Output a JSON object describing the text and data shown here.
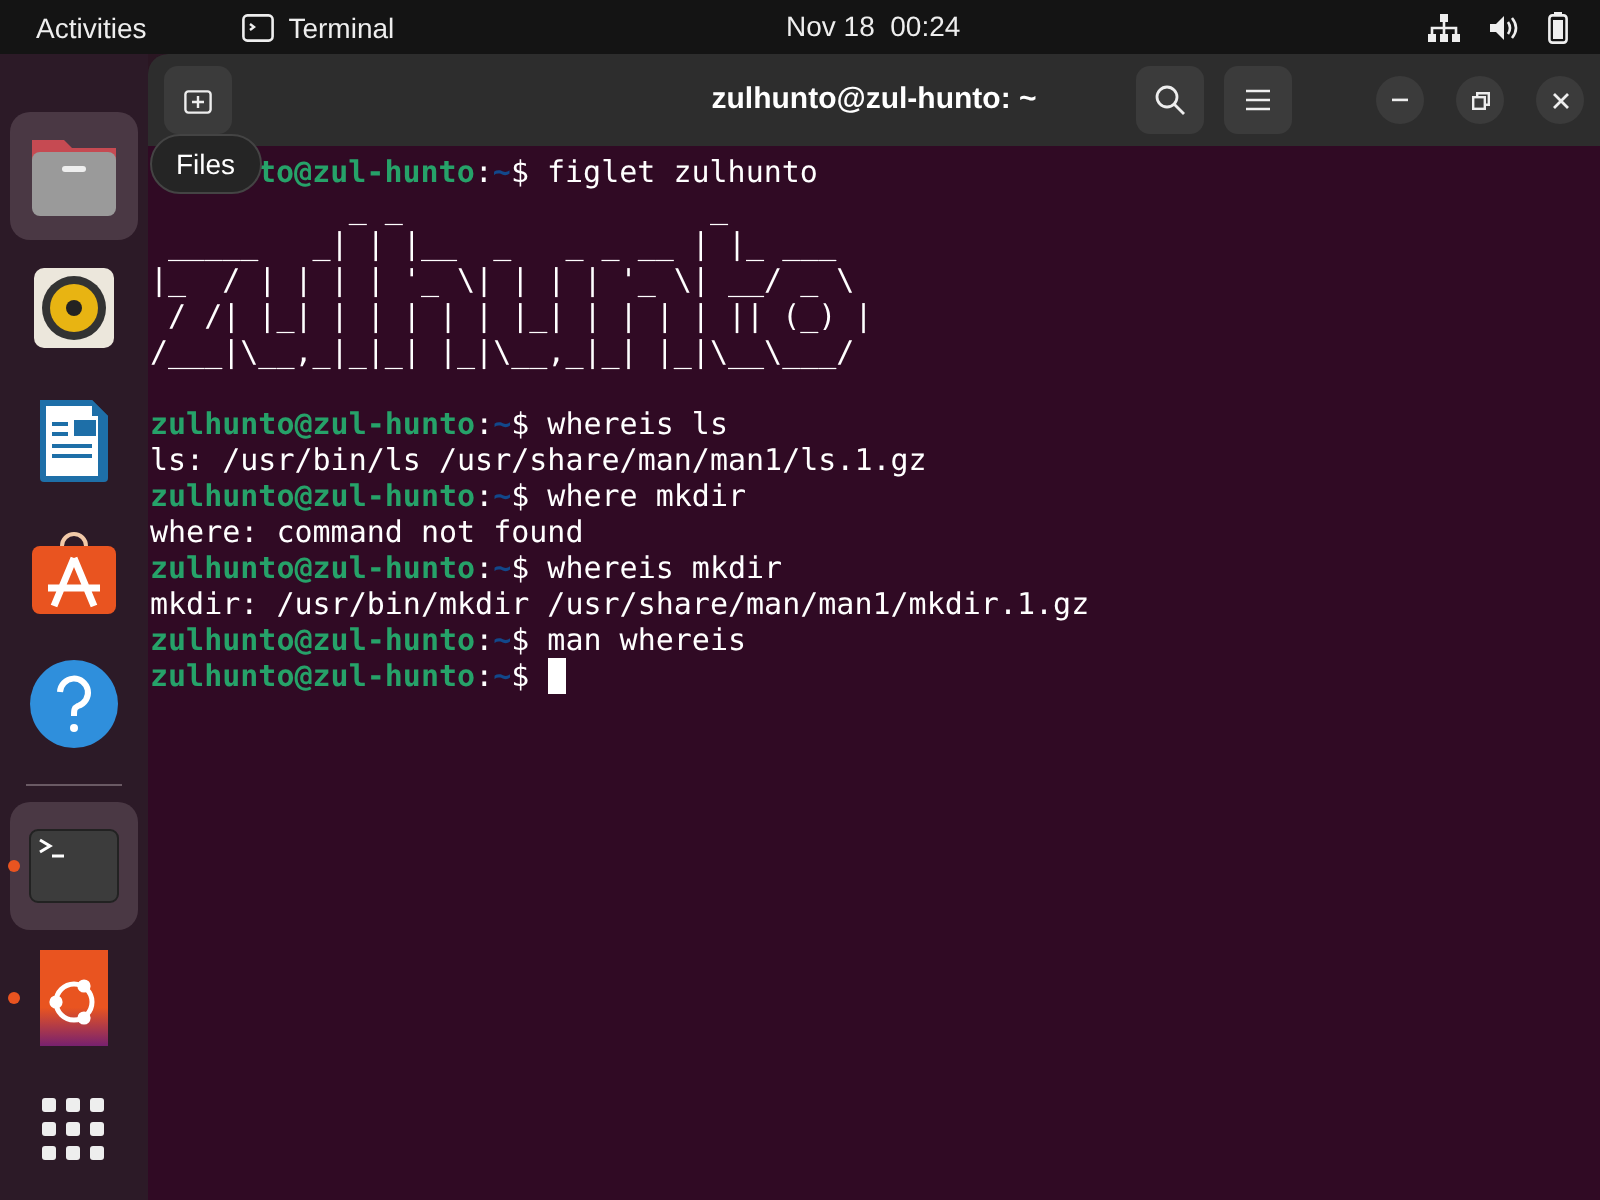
{
  "top_bar": {
    "activities": "Activities",
    "app_name": "Terminal",
    "clock": "Nov 18  00:24"
  },
  "dock": {
    "items": [
      {
        "kind": "files",
        "highlighted": true,
        "running": false
      },
      {
        "kind": "rhythmbox",
        "highlighted": false,
        "running": false
      },
      {
        "kind": "writer",
        "highlighted": false,
        "running": false
      },
      {
        "kind": "appcenter",
        "highlighted": false,
        "running": false
      },
      {
        "kind": "help",
        "highlighted": false,
        "running": false
      },
      {
        "kind": "separator"
      },
      {
        "kind": "terminal",
        "highlighted": true,
        "running": true
      },
      {
        "kind": "ubuntu",
        "highlighted": false,
        "running": true
      },
      {
        "kind": "apps",
        "highlighted": false,
        "running": false
      }
    ],
    "tooltip": "Files"
  },
  "window": {
    "title": "zulhunto@zul-hunto: ~"
  },
  "terminal": {
    "lines": [
      {
        "kind": "covered_prompt",
        "user": "to@zul-hunto",
        "colon": ":",
        "path": "~",
        "symbol": "$",
        "command": "figlet zulhunto",
        "cursor": false
      },
      {
        "kind": "output",
        "text": "           _ _                 _"
      },
      {
        "kind": "output",
        "text": " _____   _| | |__  _   _ _ __ | |_ ___"
      },
      {
        "kind": "output",
        "text": "|_  / | | | | '_ \\| | | | '_ \\| __/ _ \\"
      },
      {
        "kind": "output",
        "text": " / /| |_| | | | | | |_| | | | | || (_) |"
      },
      {
        "kind": "output",
        "text": "/___|\\__,_|_|_| |_|\\__,_|_| |_|\\__\\___/"
      },
      {
        "kind": "blank"
      },
      {
        "kind": "prompt",
        "user": "zulhunto@zul-hunto",
        "colon": ":",
        "path": "~",
        "symbol": "$",
        "command": "whereis ls",
        "cursor": false
      },
      {
        "kind": "output",
        "text": "ls: /usr/bin/ls /usr/share/man/man1/ls.1.gz"
      },
      {
        "kind": "prompt",
        "user": "zulhunto@zul-hunto",
        "colon": ":",
        "path": "~",
        "symbol": "$",
        "command": "where mkdir",
        "cursor": false
      },
      {
        "kind": "output",
        "text": "where: command not found"
      },
      {
        "kind": "prompt",
        "user": "zulhunto@zul-hunto",
        "colon": ":",
        "path": "~",
        "symbol": "$",
        "command": "whereis mkdir",
        "cursor": false
      },
      {
        "kind": "output",
        "text": "mkdir: /usr/bin/mkdir /usr/share/man/man1/mkdir.1.gz"
      },
      {
        "kind": "prompt",
        "user": "zulhunto@zul-hunto",
        "colon": ":",
        "path": "~",
        "symbol": "$",
        "command": "man whereis",
        "cursor": false
      },
      {
        "kind": "prompt",
        "user": "zulhunto@zul-hunto",
        "colon": ":",
        "path": "~",
        "symbol": "$",
        "cursor": true
      }
    ]
  }
}
